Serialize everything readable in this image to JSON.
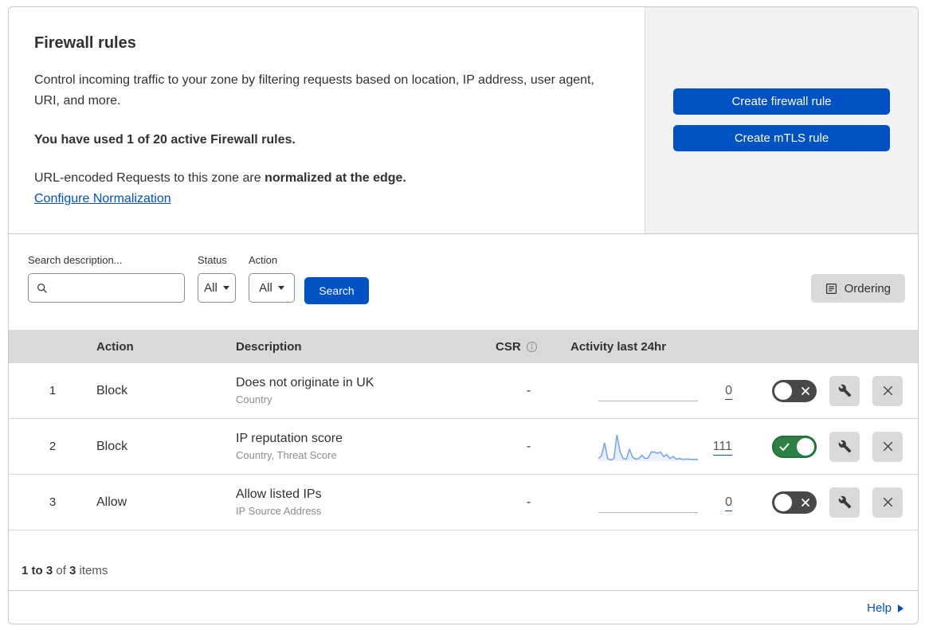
{
  "colors": {
    "accent_blue": "#0051c3",
    "toggle_on_green": "#2c8045",
    "toggle_off_gray": "#46484a",
    "sparkline_stroke": "#74a2ec",
    "sparkline_fill": "rgba(116,162,236,0.16)",
    "table_header_bg": "#d9d9d9",
    "panel_gray": "#f2f2f2"
  },
  "header": {
    "title": "Firewall rules",
    "description": "Control incoming traffic to your zone by filtering requests based on location, IP address, user agent, URI, and more.",
    "usage_text": "You have used 1 of 20 active Firewall rules.",
    "normalization_prefix": "URL-encoded Requests to this zone are ",
    "normalization_bold": "normalized at the edge.",
    "normalization_link": "Configure Normalization",
    "create_firewall_button": "Create firewall rule",
    "create_mtls_button": "Create mTLS rule"
  },
  "filters": {
    "search_label": "Search description...",
    "status_label": "Status",
    "status_value": "All",
    "action_label": "Action",
    "action_value": "All",
    "search_button": "Search",
    "ordering_button": "Ordering"
  },
  "table": {
    "columns": {
      "action": "Action",
      "description": "Description",
      "csr": "CSR",
      "activity": "Activity last 24hr"
    },
    "rows": [
      {
        "index": "1",
        "action": "Block",
        "title": "Does not originate in UK",
        "subtitle": "Country",
        "csr": "-",
        "activity_count": "0",
        "enabled": false
      },
      {
        "index": "2",
        "action": "Block",
        "title": "IP reputation score",
        "subtitle": "Country, Threat Score",
        "csr": "-",
        "activity_count": "111",
        "enabled": true,
        "sparkline_values": [
          0.1,
          0.2,
          0.7,
          0.1,
          0.05,
          0.1,
          1.0,
          0.35,
          0.1,
          0.08,
          0.45,
          0.15,
          0.08,
          0.1,
          0.22,
          0.1,
          0.12,
          0.35,
          0.35,
          0.3,
          0.35,
          0.18,
          0.25,
          0.1,
          0.18,
          0.08,
          0.1,
          0.07,
          0.08,
          0.08,
          0.07,
          0.07,
          0.07
        ]
      },
      {
        "index": "3",
        "action": "Allow",
        "title": "Allow listed IPs",
        "subtitle": "IP Source Address",
        "csr": "-",
        "activity_count": "0",
        "enabled": false
      }
    ]
  },
  "footer": {
    "range_bold": "1 to 3",
    "of_text": " of ",
    "total_bold": "3",
    "items_text": " items",
    "help_label": "Help"
  }
}
